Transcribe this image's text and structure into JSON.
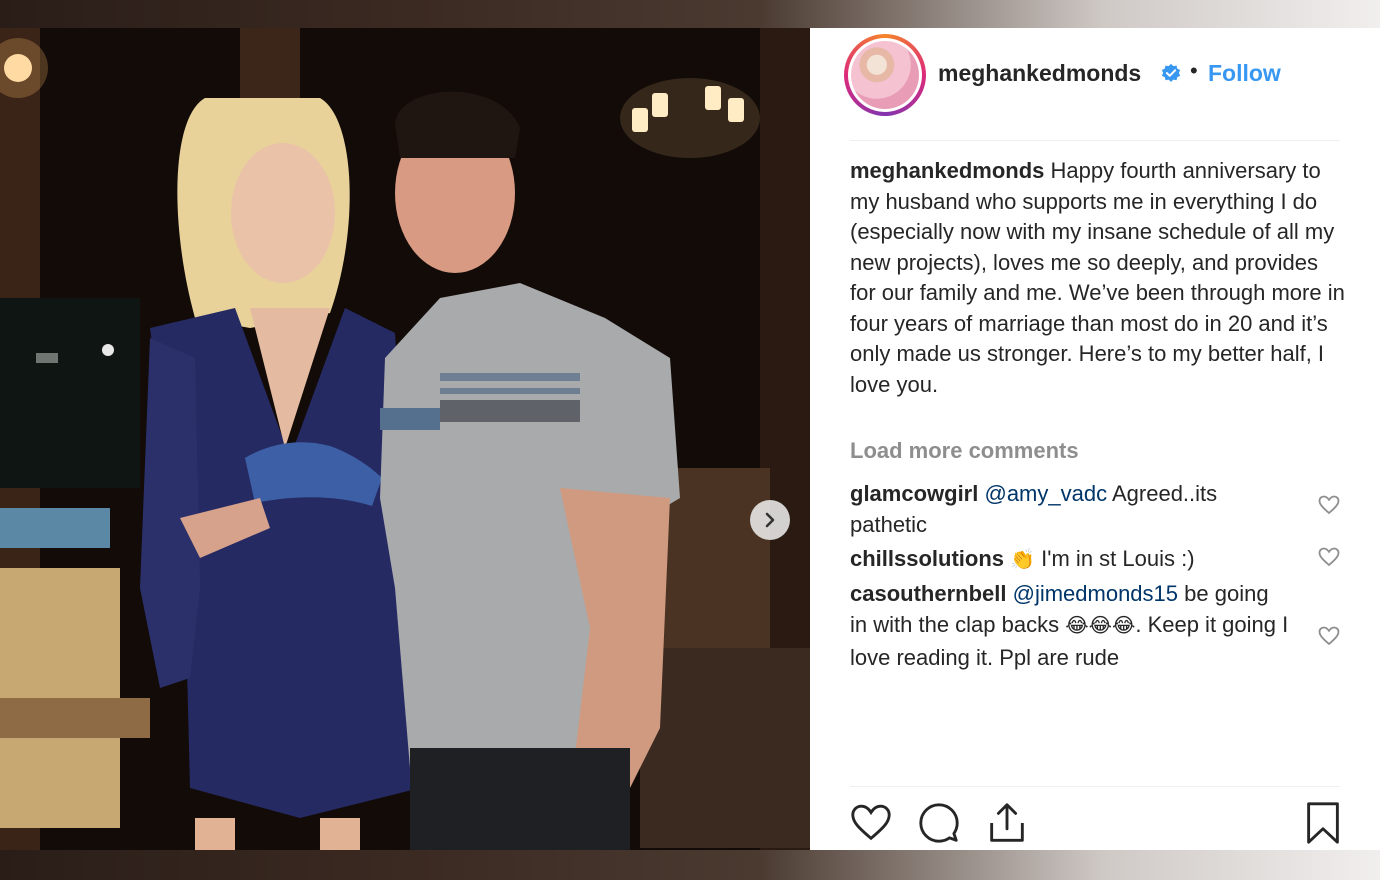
{
  "post": {
    "username": "meghankedmonds",
    "dot": "•",
    "follow_label": "Follow",
    "caption_text": "Happy fourth anniversary to my husband who supports me in everything I do (especially now with my insane schedule of all my new projects), loves me so deeply, and provides for our family and me. We’ve been through more in four years of marriage than most do in 20 and it’s only made us stronger. Here’s to my better half, I love you.",
    "load_more": "Load more comments"
  },
  "comments": [
    {
      "user": "glamcowgirl",
      "mention": "@amy_vadc",
      "text": " Agreed..its pathetic"
    },
    {
      "user": "chillssolutions",
      "emoji": "👏",
      "text": " I'm in st Louis :)"
    },
    {
      "user": "casouthernbell",
      "mention": "@jimedmonds15",
      "text_a": " be going in with the clap backs ",
      "emoji": "😂😂😂",
      "text_b": ". Keep it going I love reading it. Ppl are rude"
    }
  ],
  "colors": {
    "link_blue": "#3897f0",
    "mention_blue": "#003569",
    "muted_gray": "#8e8e8e",
    "text": "#262626"
  },
  "icons": [
    "verified-badge-icon",
    "heart-icon",
    "comment-icon",
    "share-icon",
    "bookmark-icon",
    "chevron-right-icon"
  ]
}
